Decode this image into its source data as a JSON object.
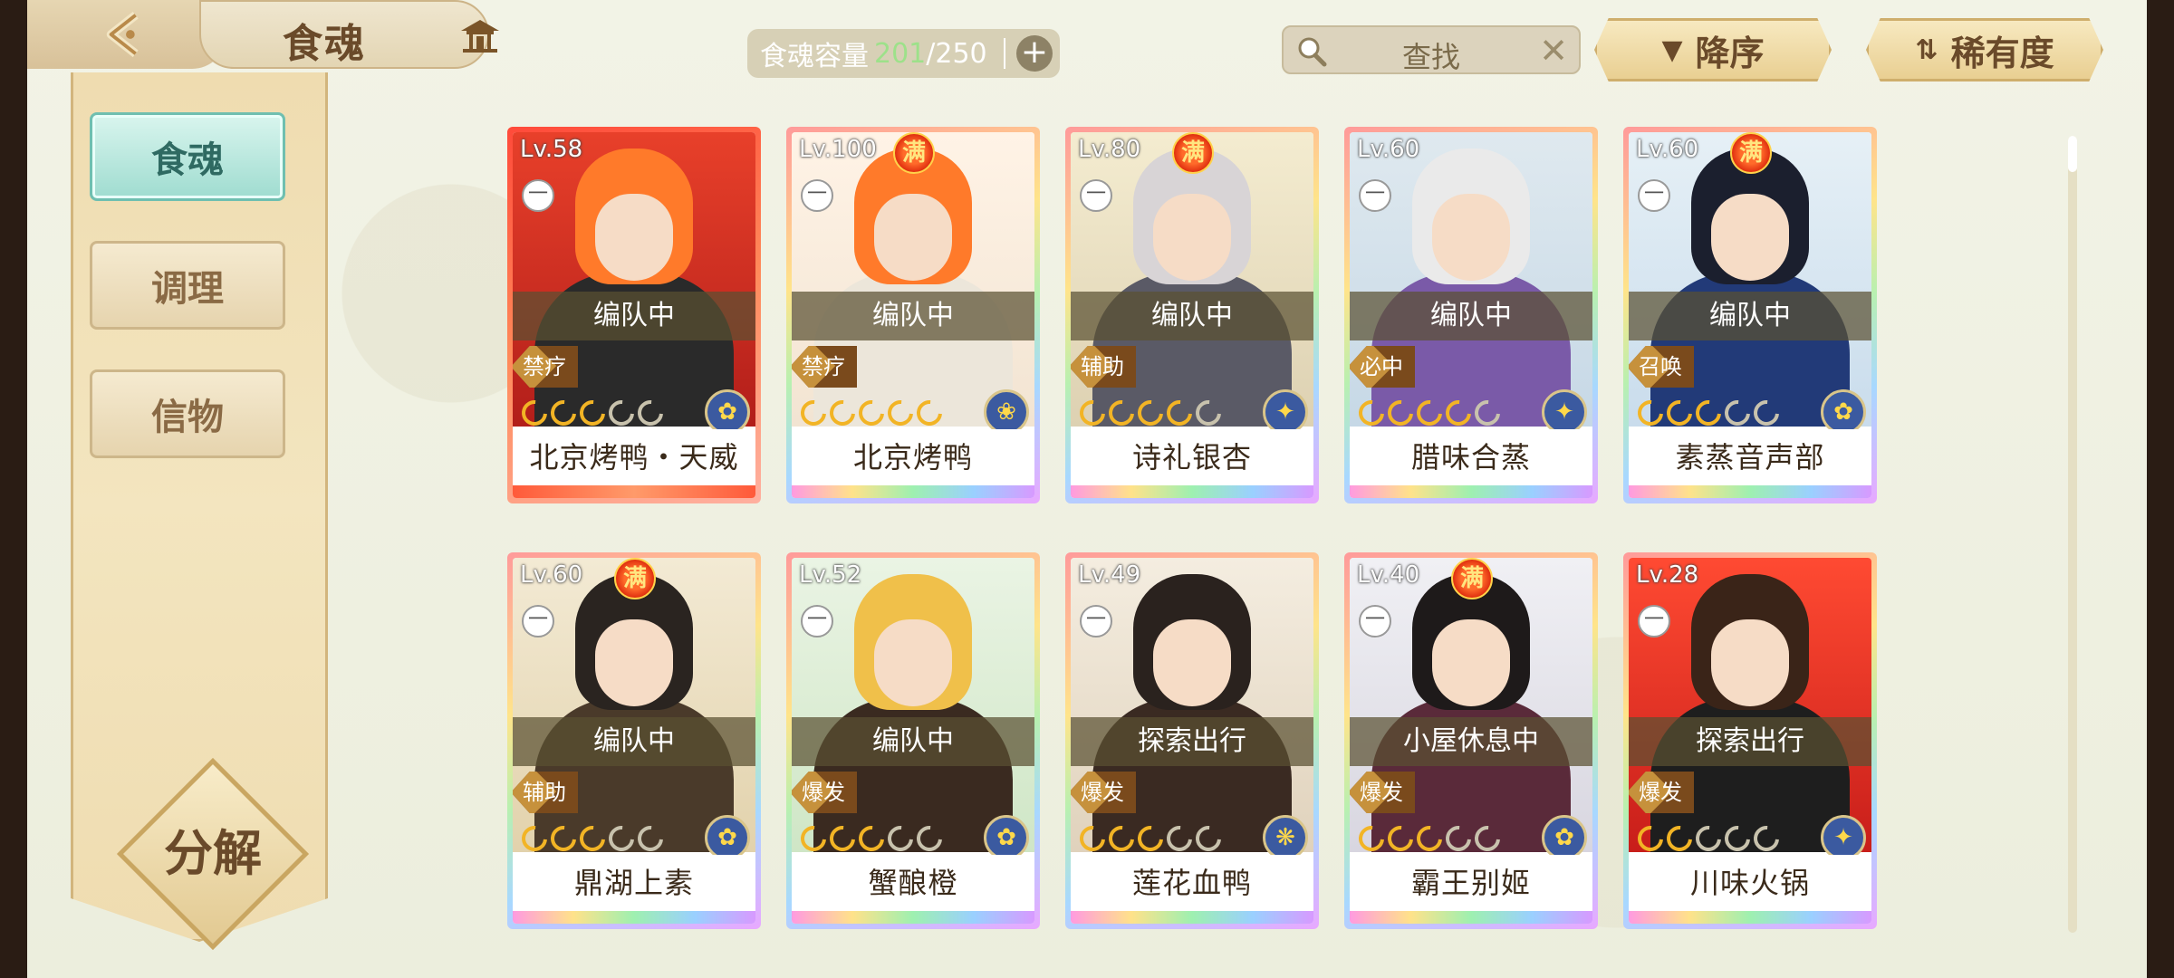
{
  "header": {
    "title": "食魂",
    "capacity_label": "食魂容量",
    "capacity_current": "201",
    "capacity_max": "/250",
    "search_label": "查找",
    "sort_label": "降序",
    "rarity_label": "稀有度"
  },
  "sidebar": {
    "tabs": [
      {
        "label": "食魂",
        "active": true
      },
      {
        "label": "调理",
        "active": false
      },
      {
        "label": "信物",
        "active": false
      }
    ],
    "decompose_label": "分解"
  },
  "cards": [
    {
      "level": "Lv.58",
      "maxed": false,
      "max_label": "",
      "status": "编队中",
      "role": "禁疗",
      "stars": 3,
      "name": "北京烤鸭・天威",
      "frame": "red",
      "element": "water"
    },
    {
      "level": "Lv.100",
      "maxed": true,
      "max_label": "满",
      "status": "编队中",
      "role": "禁疗",
      "stars": 5,
      "name": "北京烤鸭",
      "frame": "rainbow",
      "element": "flower"
    },
    {
      "level": "Lv.80",
      "maxed": true,
      "max_label": "满",
      "status": "编队中",
      "role": "辅助",
      "stars": 4,
      "name": "诗礼银杏",
      "frame": "rainbow",
      "element": "fire"
    },
    {
      "level": "Lv.60",
      "maxed": false,
      "max_label": "",
      "status": "编队中",
      "role": "必中",
      "stars": 4,
      "name": "腊味合蒸",
      "frame": "rainbow",
      "element": "fire"
    },
    {
      "level": "Lv.60",
      "maxed": true,
      "max_label": "满",
      "status": "编队中",
      "role": "召唤",
      "stars": 3,
      "name": "素蒸音声部",
      "frame": "rainbow",
      "element": "water"
    },
    {
      "level": "Lv.60",
      "maxed": true,
      "max_label": "满",
      "status": "编队中",
      "role": "辅助",
      "stars": 3,
      "name": "鼎湖上素",
      "frame": "rainbow",
      "element": "water"
    },
    {
      "level": "Lv.52",
      "maxed": false,
      "max_label": "",
      "status": "编队中",
      "role": "爆发",
      "stars": 3,
      "name": "蟹酿橙",
      "frame": "rainbow",
      "element": "water"
    },
    {
      "level": "Lv.49",
      "maxed": false,
      "max_label": "",
      "status": "探索出行",
      "role": "爆发",
      "stars": 3,
      "name": "莲花血鸭",
      "frame": "rainbow",
      "element": "wind"
    },
    {
      "level": "Lv.40",
      "maxed": true,
      "max_label": "满",
      "status": "小屋休息中",
      "role": "爆发",
      "stars": 3,
      "name": "霸王别姬",
      "frame": "rainbow",
      "element": "water"
    },
    {
      "level": "Lv.28",
      "maxed": false,
      "max_label": "",
      "status": "探索出行",
      "role": "爆发",
      "stars": 2,
      "name": "川味火锅",
      "frame": "rainbow",
      "element": "fire"
    }
  ],
  "colors": {
    "accent_teal": "#9fdcd0",
    "capacity_green": "#9de18a",
    "panel_tan": "#efdcb0"
  },
  "icons": {
    "back": "back-arrow-icon",
    "pavilion": "pavilion-icon",
    "search": "search-icon",
    "clear": "close-icon",
    "add": "plus-icon",
    "sort": "triangle-down-icon",
    "rarity": "sort-arrows-icon"
  }
}
